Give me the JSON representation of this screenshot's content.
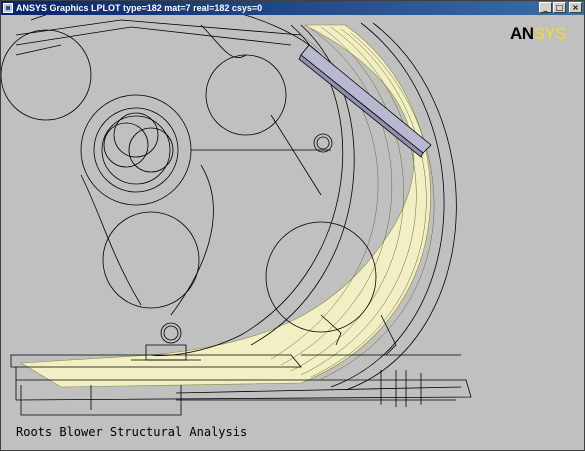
{
  "window": {
    "title": "ANSYS Graphics   LPLOT  type=182 mat=7 real=182 csys=0",
    "minimize_glyph": "_",
    "maximize_glyph": "□",
    "close_glyph": "×"
  },
  "logo": {
    "part1": "AN",
    "part2": "SYS"
  },
  "plot": {
    "caption": "Roots Blower Structural Analysis"
  },
  "colors": {
    "background": "#c0c0c0",
    "area_fill": "#f2efc4",
    "line": "#000000",
    "logo_accent": "#f0e020",
    "titlebar": "#0a246a"
  },
  "icons": {
    "app": "ansys-app-icon"
  }
}
